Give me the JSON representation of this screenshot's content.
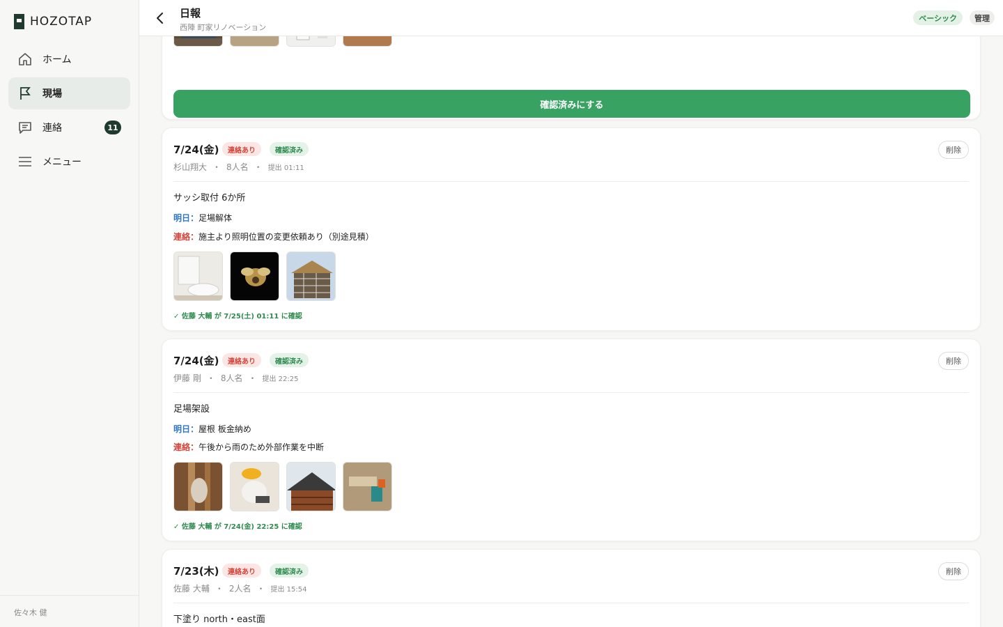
{
  "app": {
    "name": "HOZOTAP"
  },
  "sidebar": {
    "items": [
      {
        "label": "ホーム",
        "icon": "home-icon"
      },
      {
        "label": "現場",
        "icon": "flag-icon"
      },
      {
        "label": "連絡",
        "icon": "chat-icon",
        "badge": "11"
      },
      {
        "label": "メニュー",
        "icon": "menu-icon"
      }
    ],
    "user": "佐々木 健"
  },
  "header": {
    "title": "日報",
    "subtitle": "西陣 町家リノベーション",
    "plan": "ベーシック",
    "role": "管理"
  },
  "top_card": {
    "confirm_label": "確認済みにする"
  },
  "reports": [
    {
      "date": "7/24(金)",
      "badge_contact": "連絡あり",
      "badge_confirmed": "確認済み",
      "author": "杉山翔大",
      "workers": "8人名",
      "submitted": "提出 01:11",
      "delete_label": "削除",
      "work": "サッシ取付 6か所",
      "tomorrow_label": "明日：",
      "tomorrow": "足場解体",
      "contact_label": "連絡：",
      "contact": "施主より照明位置の変更依頼あり（別途見積）",
      "ack": "✓ 佐藤 大輔 が 7/25(土) 01:11 に確認"
    },
    {
      "date": "7/24(金)",
      "badge_contact": "連絡あり",
      "badge_confirmed": "確認済み",
      "author": "伊藤 剛",
      "workers": "8人名",
      "submitted": "提出 22:25",
      "delete_label": "削除",
      "work": "足場架設",
      "tomorrow_label": "明日：",
      "tomorrow": "屋根 板金納め",
      "contact_label": "連絡：",
      "contact": "午後から雨のため外部作業を中断",
      "ack": "✓ 佐藤 大輔 が 7/24(金) 22:25 に確認"
    },
    {
      "date": "7/23(木)",
      "badge_contact": "連絡あり",
      "badge_confirmed": "確認済み",
      "author": "佐藤 大輔",
      "workers": "2人名",
      "submitted": "提出 15:54",
      "delete_label": "削除",
      "work": "下塗り north・east面"
    }
  ],
  "colors": {
    "accent": "#37a262",
    "brand": "#1f3b2d",
    "contact_red": "#d2453a",
    "tomorrow_blue": "#2f75c9"
  }
}
